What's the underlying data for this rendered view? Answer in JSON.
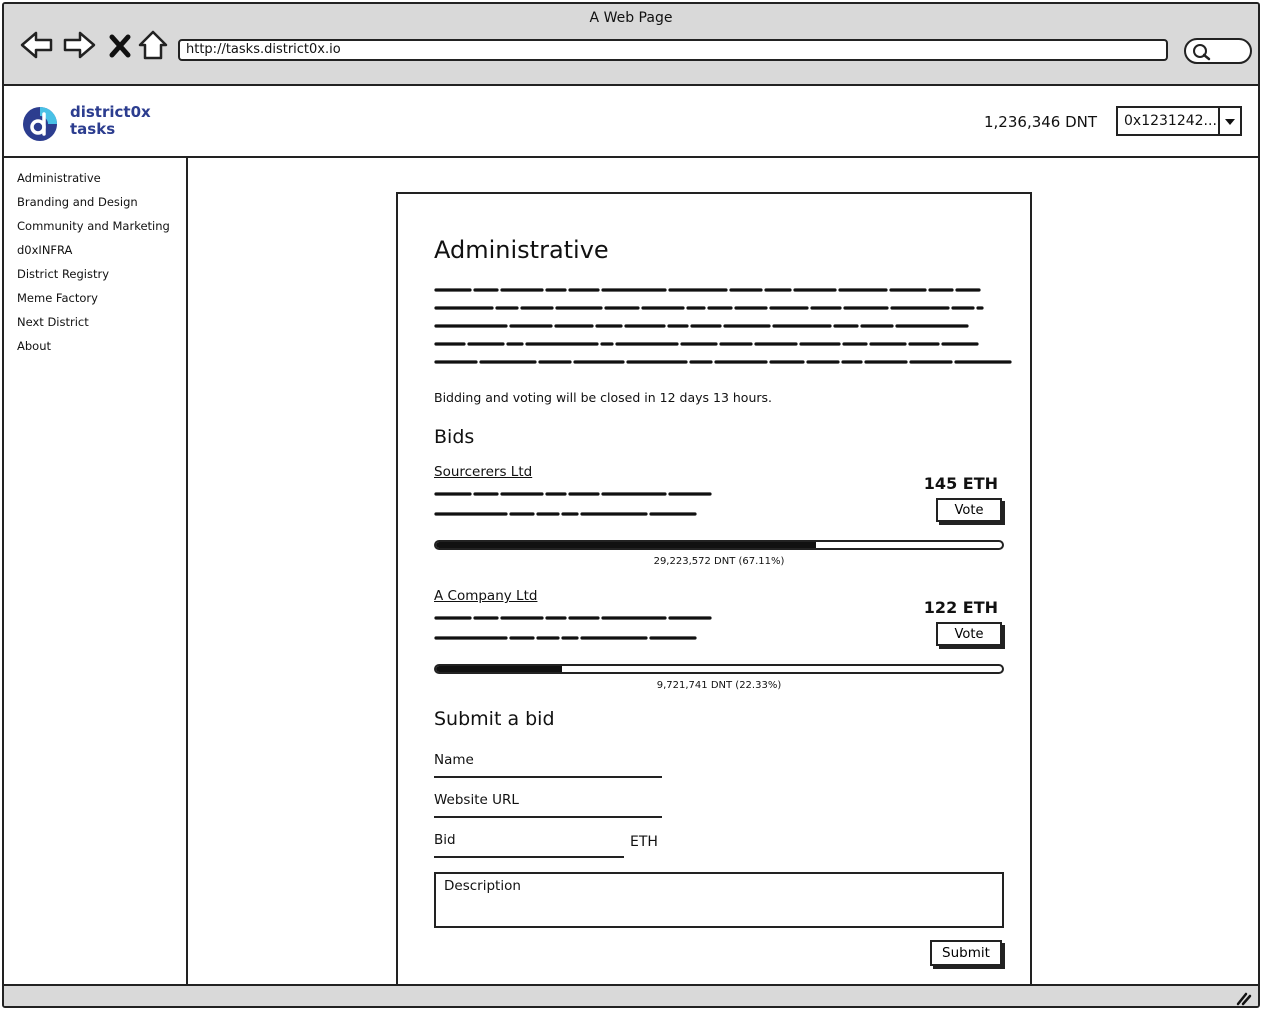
{
  "browser": {
    "window_title": "A Web Page",
    "url": "http://tasks.district0x.io"
  },
  "header": {
    "logo_line1": "district0x",
    "logo_line2": "tasks",
    "balance": "1,236,346 DNT",
    "account": "0x1231242..."
  },
  "sidebar": {
    "items": [
      {
        "label": "Administrative"
      },
      {
        "label": "Branding and Design"
      },
      {
        "label": "Community and Marketing"
      },
      {
        "label": "d0xINFRA"
      },
      {
        "label": "District Registry"
      },
      {
        "label": "Meme Factory"
      },
      {
        "label": "Next District"
      },
      {
        "label": "About"
      }
    ]
  },
  "task": {
    "title": "Administrative",
    "deadline": "Bidding and voting will be closed in 12 days 13 hours.",
    "bids_heading": "Bids",
    "bids": [
      {
        "bidder": "Sourcerers Ltd",
        "amount": "145 ETH",
        "vote_label": "Vote",
        "votes_text": "29,223,572 DNT (67.11%)",
        "vote_share": 0.6711
      },
      {
        "bidder": "A Company Ltd",
        "amount": "122 ETH",
        "vote_label": "Vote",
        "votes_text": "9,721,741 DNT (22.33%)",
        "vote_share": 0.2233
      }
    ]
  },
  "submit_form": {
    "heading": "Submit a bid",
    "name_label": "Name",
    "website_label": "Website URL",
    "bid_label": "Bid",
    "bid_unit": "ETH",
    "description_placeholder": "Description",
    "submit_label": "Submit"
  },
  "colors": {
    "chrome": "#d9d9d9",
    "logo_blue": "#2c3d8f",
    "logo_cyan": "#49c1e6"
  }
}
